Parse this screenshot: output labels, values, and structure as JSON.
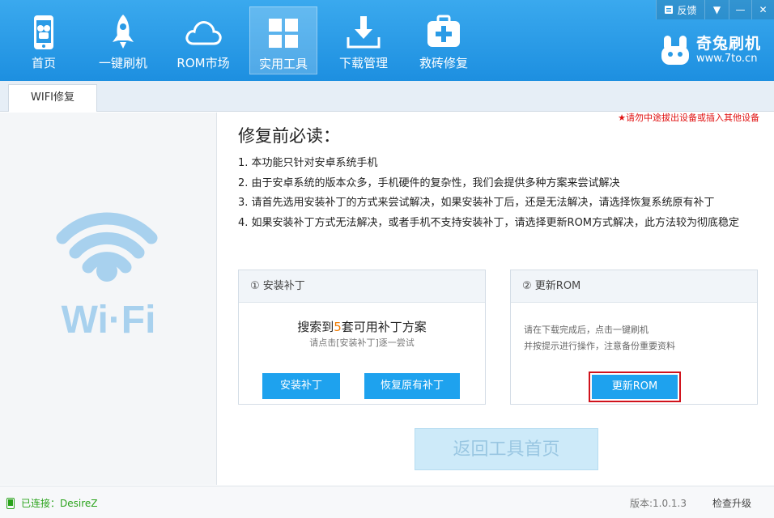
{
  "nav": [
    {
      "label": "首页",
      "icon": "phone-icon"
    },
    {
      "label": "一键刷机",
      "icon": "rocket-icon"
    },
    {
      "label": "ROM市场",
      "icon": "cloud-icon"
    },
    {
      "label": "实用工具",
      "icon": "grid-icon",
      "active": true
    },
    {
      "label": "下载管理",
      "icon": "download-icon"
    },
    {
      "label": "救砖修复",
      "icon": "first-aid-icon"
    }
  ],
  "window": {
    "feedback": "反馈"
  },
  "brand": {
    "name": "奇兔刷机",
    "url": "www.7to.cn"
  },
  "tab": {
    "label": "WIFI修复"
  },
  "warning": "★请勿中途拔出设备或插入其他设备",
  "main": {
    "title": "修复前必读：",
    "notes": [
      "1. 本功能只针对安卓系统手机",
      "2. 由于安卓系统的版本众多，手机硬件的复杂性，我们会提供多种方案来尝试解决",
      "3. 请首先选用安装补丁的方式来尝试解决，如果安装补丁后，还是无法解决，请选择恢复系统原有补丁",
      "4. 如果安装补丁方式无法解决，或者手机不支持安装补丁，请选择更新ROM方式解决，此方法较为彻底稳定"
    ]
  },
  "card1": {
    "title": "① 安装补丁",
    "found_prefix": "搜索到",
    "found_count": "5",
    "found_suffix": "套可用补丁方案",
    "hint": "请点击[安装补丁]逐一尝试",
    "install_btn": "安装补丁",
    "restore_btn": "恢复原有补丁"
  },
  "card2": {
    "title": "② 更新ROM",
    "hint1": "请在下载完成后，点击一键刷机",
    "hint2": "并按提示进行操作，注意备份重要资料",
    "update_btn": "更新ROM"
  },
  "back_btn": "返回工具首页",
  "status": {
    "connected": "已连接：DesireZ",
    "version": "版本:1.0.1.3",
    "upgrade": "检查升级"
  },
  "wifi_text": "Wi·Fi",
  "colors": {
    "accent": "#1ea2ee",
    "header": "#2a9be6",
    "warning": "#e01010",
    "highlight": "#d0121c"
  }
}
